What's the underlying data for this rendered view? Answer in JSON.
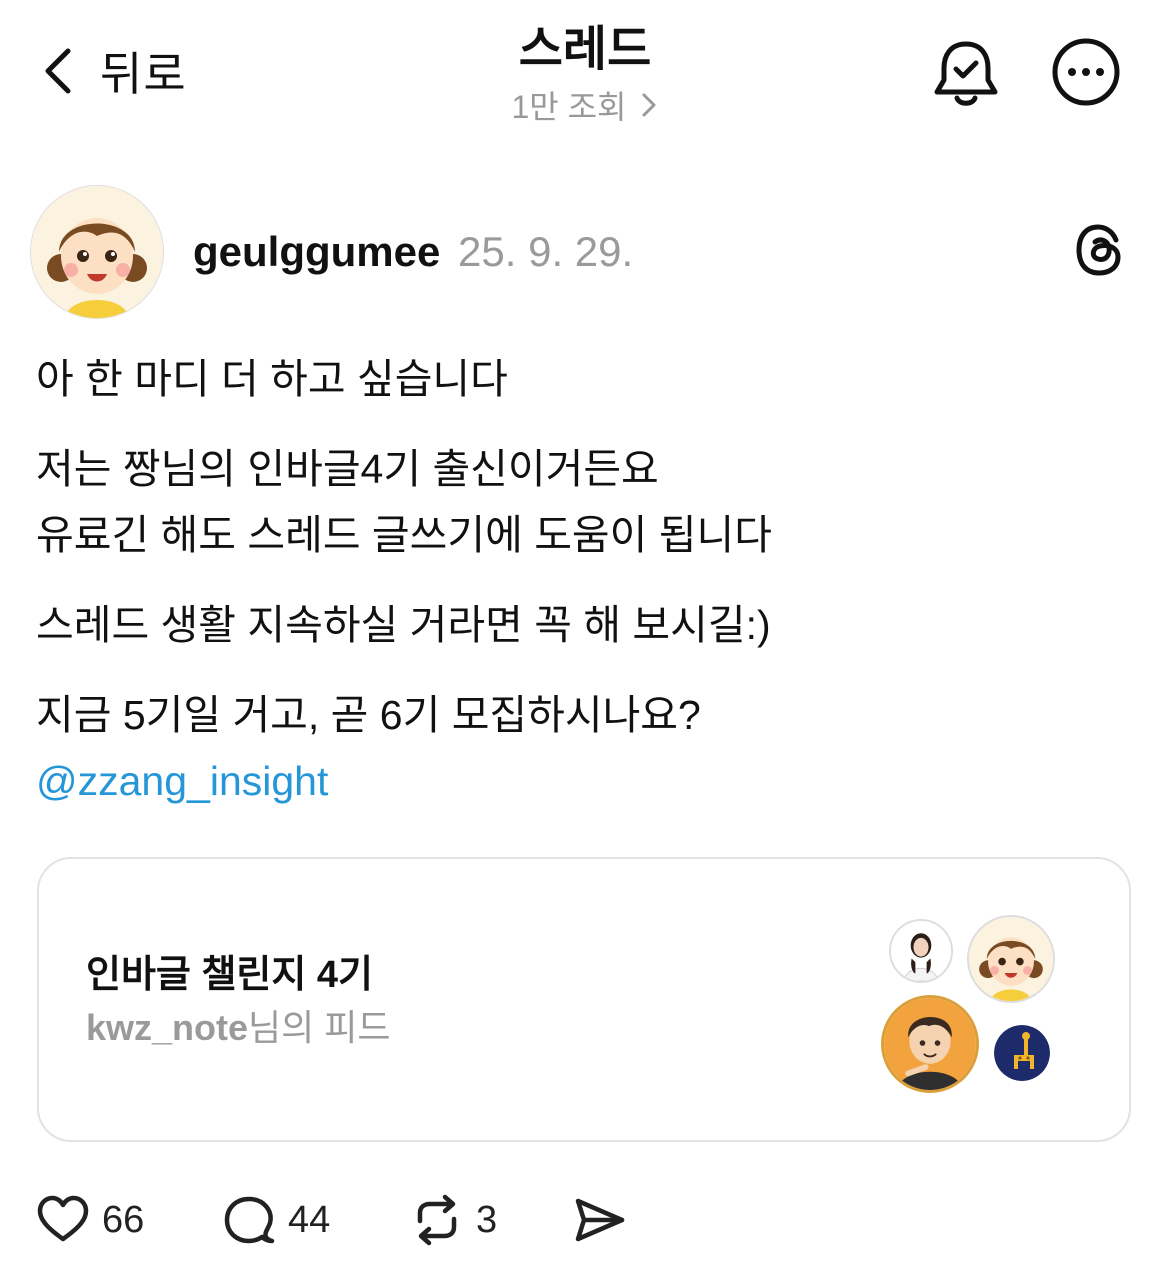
{
  "header": {
    "back_label": "뒤로",
    "title": "스레드",
    "views": "1만 조회"
  },
  "post": {
    "username": "geulggumee",
    "date": "25. 9. 29.",
    "lines": [
      "아 한 마디 더 하고 싶습니다",
      "저는 짱님의 인바글4기 출신이거든요",
      "유료긴 해도 스레드 글쓰기에 도움이 됩니다",
      "스레드 생활 지속하실 거라면 꼭 해 보시길:)",
      "지금 5기일 거고, 곧 6기 모집하시나요?"
    ],
    "mention": "@zzang_insight"
  },
  "card": {
    "title": "인바글 챌린지 4기",
    "owner": "kwz_note",
    "owner_suffix": "님의 피드"
  },
  "actions": {
    "likes": "66",
    "replies": "44",
    "reposts": "3"
  },
  "icons": {
    "back": "chevron-left-icon",
    "views_chevron": "chevron-right-icon",
    "bell": "bell-check-icon",
    "more": "more-horizontal-icon",
    "threads": "threads-logo-icon",
    "like": "heart-icon",
    "reply": "comment-icon",
    "repost": "repost-icon",
    "share": "send-icon"
  },
  "colors": {
    "mention": "#2596d8",
    "secondary_text": "#9a9a9a",
    "card_border": "#e2e2e2"
  }
}
